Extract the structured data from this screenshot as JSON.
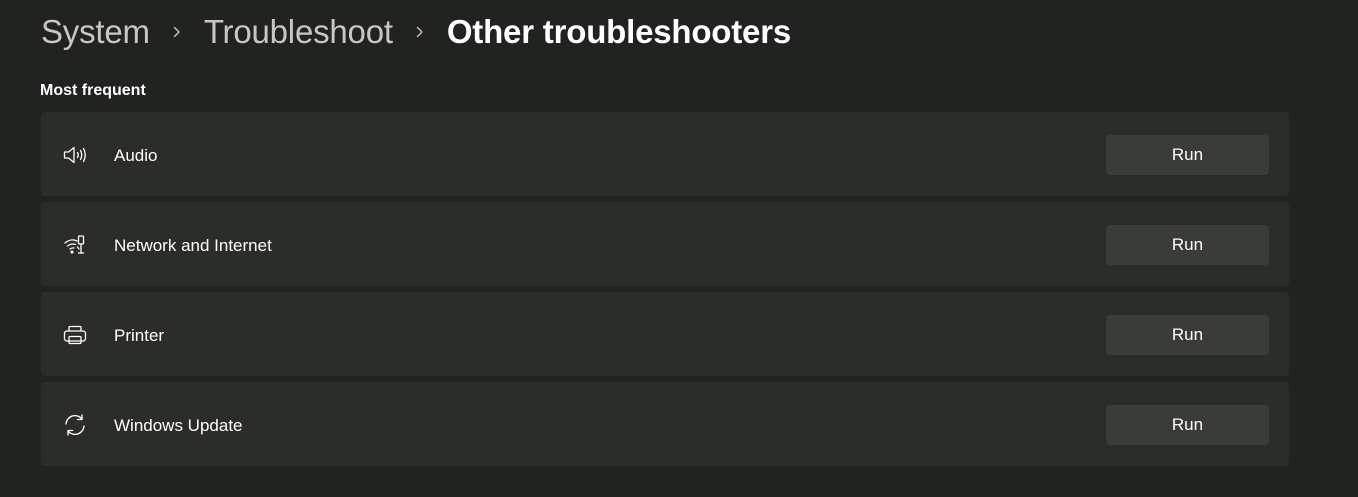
{
  "breadcrumb": {
    "items": [
      "System",
      "Troubleshoot"
    ],
    "current": "Other troubleshooters"
  },
  "section": {
    "title": "Most frequent"
  },
  "troubleshooters": [
    {
      "label": "Audio",
      "icon": "speaker-icon",
      "button": "Run"
    },
    {
      "label": "Network and Internet",
      "icon": "network-icon",
      "button": "Run"
    },
    {
      "label": "Printer",
      "icon": "printer-icon",
      "button": "Run"
    },
    {
      "label": "Windows Update",
      "icon": "sync-icon",
      "button": "Run"
    }
  ],
  "colors": {
    "background": "#20231f",
    "card": "#2b2e28",
    "button": "#3a3d37",
    "text": "#ffffff",
    "breadcrumb_parent": "#c7c8c5"
  }
}
